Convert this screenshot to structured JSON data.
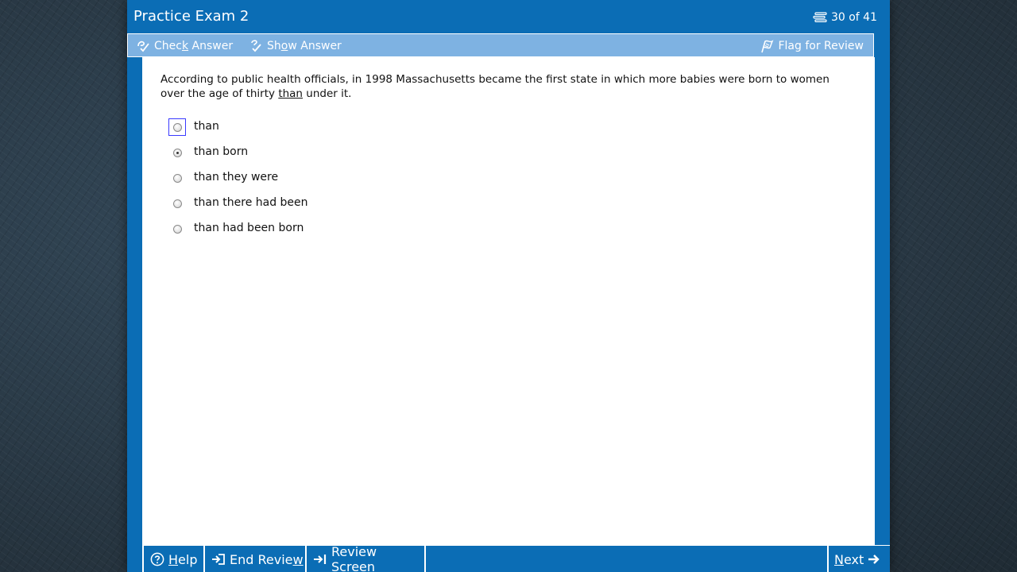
{
  "header": {
    "title": "Practice Exam 2",
    "progress": "30 of 41"
  },
  "toolbar": {
    "check_answer": {
      "pre": "Chec",
      "key": "k",
      "post": " Answer"
    },
    "show_answer": {
      "pre": "Sh",
      "key": "o",
      "post": "w Answer"
    },
    "flag_for_review": "Flag for Review"
  },
  "question": {
    "text_before": "According to public health officials, in 1998 Massachusetts became the first state in which more babies were born to women over the age of thirty ",
    "underlined": "than",
    "text_after": " under it."
  },
  "answers": [
    {
      "label": "than",
      "selected": false,
      "focused": true
    },
    {
      "label": "than born",
      "selected": true,
      "focused": false
    },
    {
      "label": "than they were",
      "selected": false,
      "focused": false
    },
    {
      "label": "than there had been",
      "selected": false,
      "focused": false
    },
    {
      "label": "than had been born",
      "selected": false,
      "focused": false
    }
  ],
  "bottom_nav": {
    "help": {
      "key": "H",
      "post": "elp"
    },
    "end_review": {
      "pre": "End Revie",
      "key": "w",
      "post": ""
    },
    "review_screen": {
      "pre": "Review Sc",
      "key": "r",
      "post": "een"
    },
    "next": {
      "key": "N",
      "post": "ext"
    }
  },
  "colors": {
    "frame_blue": "#0b6db5",
    "toolbar_blue": "#7eb2e2",
    "focus_outline": "#3a3aff"
  },
  "icons": {
    "progress": "list-icon",
    "check_answer": "check-answer-icon",
    "show_answer": "show-answer-icon",
    "flag": "flag-icon",
    "help": "help-circle-icon",
    "end_review": "end-review-icon",
    "review_screen": "review-screen-icon",
    "next": "arrow-right-icon"
  }
}
